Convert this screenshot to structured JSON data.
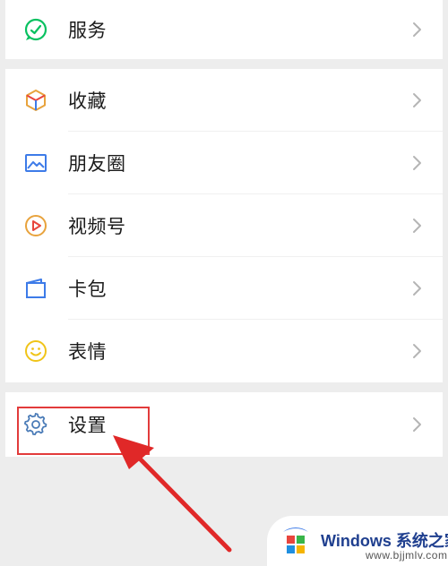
{
  "menu": {
    "service": {
      "label": "服务",
      "icon": "service-icon"
    },
    "items": [
      {
        "label": "收藏",
        "icon": "favorites-icon"
      },
      {
        "label": "朋友圈",
        "icon": "moments-icon"
      },
      {
        "label": "视频号",
        "icon": "channels-icon"
      },
      {
        "label": "卡包",
        "icon": "card-wallet-icon"
      },
      {
        "label": "表情",
        "icon": "sticker-icon"
      }
    ],
    "settings": {
      "label": "设置",
      "icon": "gear-icon"
    }
  },
  "annotation": {
    "highlight_color": "#e23b3b"
  },
  "watermark": {
    "title": "Windows",
    "subtitle": "系统之家",
    "url": "www.bjjmlv.com"
  },
  "colors": {
    "background": "#ededed",
    "card": "#ffffff",
    "text": "#1b1b1b",
    "service_icon": "#07c160",
    "gear_icon": "#4a7bb7"
  }
}
